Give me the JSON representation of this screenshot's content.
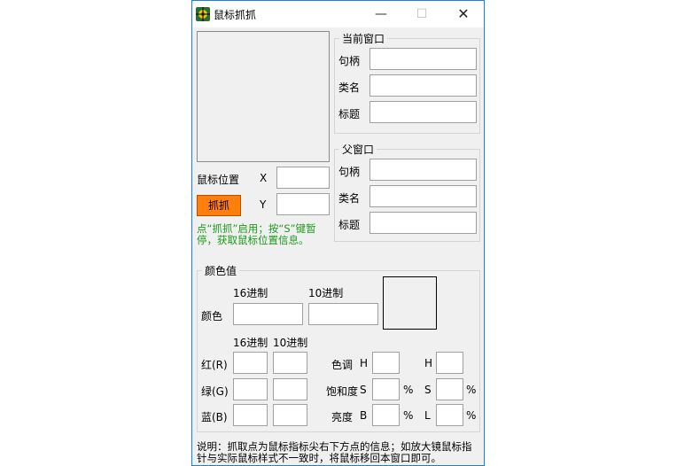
{
  "window": {
    "title": "鼠标抓抓",
    "minimize": "—",
    "maximize": "☐",
    "close": "✕"
  },
  "left": {
    "mouse_pos_label": "鼠标位置",
    "x_label": "X",
    "y_label": "Y",
    "grab_button": "抓抓",
    "hint": "点“抓抓”启用；按“S”键暂停，获取鼠标位置信息。"
  },
  "current_window": {
    "legend": "当前窗口",
    "handle_label": "句柄",
    "class_label": "类名",
    "title_label": "标题"
  },
  "parent_window": {
    "legend": "父窗口",
    "handle_label": "句柄",
    "class_label": "类名",
    "title_label": "标题"
  },
  "color_group": {
    "legend": "颜色值",
    "hex_header": "16进制",
    "dec_header": "10进制",
    "color_label": "颜色",
    "hex_header2": "16进制",
    "dec_header2": "10进制",
    "red_label": "红(R)",
    "green_label": "绿(G)",
    "blue_label": "蓝(B)",
    "hue_label": "色调",
    "sat_label": "饱和度",
    "bri_label": "亮度",
    "h1": "H",
    "s1": "S",
    "b1": "B",
    "h2": "H",
    "s2": "S",
    "l2": "L",
    "pct": "%"
  },
  "footer_note": "说明：抓取点为鼠标指标尖右下方点的信息；如放大镜鼠标指针与实际鼠标样式不一致时，将鼠标移回本窗口即可。",
  "colors": {
    "grab_button": "#ff7f0e",
    "hint_text": "#1a9a1a",
    "title_border": "#1f7fd6"
  }
}
